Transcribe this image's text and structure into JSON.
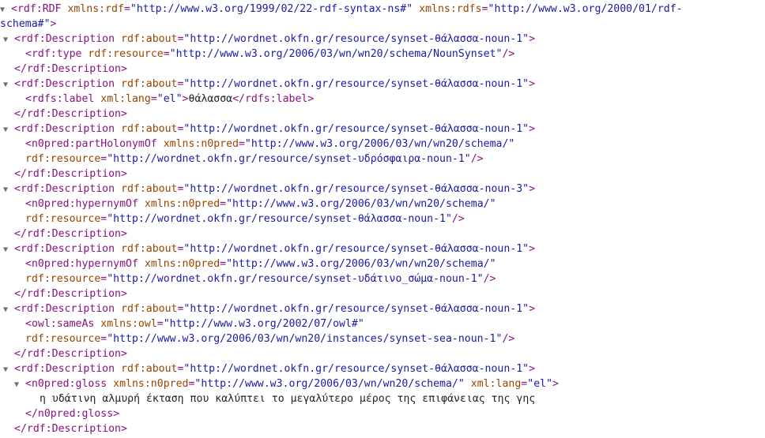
{
  "icons": {
    "toggle": "expanded-triangle-icon",
    "toggle_glyph": "▼"
  },
  "colors": {
    "tag": "#881280",
    "attr_name": "#994500",
    "attr_value": "#1a1aa6",
    "text": "#222222"
  },
  "lines": [
    {
      "indent": 0,
      "toggle": true,
      "interactable": true,
      "name": "rdf-root-open-tag",
      "tokens": [
        {
          "c": "tag",
          "t": "<rdf:RDF"
        },
        {
          "c": "tx",
          "t": " "
        },
        {
          "c": "an",
          "t": "xmlns:rdf"
        },
        {
          "c": "tag",
          "t": "="
        },
        {
          "c": "av",
          "t": "\"http://www.w3.org/1999/02/22-rdf-syntax-ns#\""
        },
        {
          "c": "tx",
          "t": " "
        },
        {
          "c": "an",
          "t": "xmlns:rdfs"
        },
        {
          "c": "tag",
          "t": "="
        },
        {
          "c": "av",
          "t": "\"http://www.w3.org/2000/01/rdf-"
        }
      ]
    },
    {
      "indent": 0,
      "toggle": false,
      "interactable": false,
      "name": "rdf-root-open-tag-cont",
      "tokens": [
        {
          "c": "av",
          "t": "schema#\""
        },
        {
          "c": "tag",
          "t": ">"
        }
      ]
    },
    {
      "indent": 1,
      "toggle": true,
      "interactable": true,
      "name": "description-open-tag",
      "tokens": [
        {
          "c": "tag",
          "t": "<rdf:Description"
        },
        {
          "c": "tx",
          "t": " "
        },
        {
          "c": "an",
          "t": "rdf:about"
        },
        {
          "c": "tag",
          "t": "="
        },
        {
          "c": "av",
          "t": "\"http://wordnet.okfn.gr/resource/synset-θάλασσα-noun-1\""
        },
        {
          "c": "tag",
          "t": ">"
        }
      ]
    },
    {
      "indent": 2,
      "toggle": false,
      "interactable": false,
      "name": "rdf-type-tag",
      "tokens": [
        {
          "c": "tag",
          "t": "<rdf:type"
        },
        {
          "c": "tx",
          "t": " "
        },
        {
          "c": "an",
          "t": "rdf:resource"
        },
        {
          "c": "tag",
          "t": "="
        },
        {
          "c": "av",
          "t": "\"http://www.w3.org/2006/03/wn/wn20/schema/NounSynset\""
        },
        {
          "c": "tag",
          "t": "/>"
        }
      ]
    },
    {
      "indent": 1,
      "toggle": false,
      "interactable": false,
      "name": "description-close-tag",
      "tokens": [
        {
          "c": "tag",
          "t": "</rdf:Description>"
        }
      ]
    },
    {
      "indent": 1,
      "toggle": true,
      "interactable": true,
      "name": "description-open-tag",
      "tokens": [
        {
          "c": "tag",
          "t": "<rdf:Description"
        },
        {
          "c": "tx",
          "t": " "
        },
        {
          "c": "an",
          "t": "rdf:about"
        },
        {
          "c": "tag",
          "t": "="
        },
        {
          "c": "av",
          "t": "\"http://wordnet.okfn.gr/resource/synset-θάλασσα-noun-1\""
        },
        {
          "c": "tag",
          "t": ">"
        }
      ]
    },
    {
      "indent": 2,
      "toggle": false,
      "interactable": false,
      "name": "rdfs-label-element",
      "tokens": [
        {
          "c": "tag",
          "t": "<rdfs:label"
        },
        {
          "c": "tx",
          "t": " "
        },
        {
          "c": "an",
          "t": "xml:lang"
        },
        {
          "c": "tag",
          "t": "="
        },
        {
          "c": "av",
          "t": "\"el\""
        },
        {
          "c": "tag",
          "t": ">"
        },
        {
          "c": "tx",
          "t": "θάλασσα"
        },
        {
          "c": "tag",
          "t": "</rdfs:label>"
        }
      ]
    },
    {
      "indent": 1,
      "toggle": false,
      "interactable": false,
      "name": "description-close-tag",
      "tokens": [
        {
          "c": "tag",
          "t": "</rdf:Description>"
        }
      ]
    },
    {
      "indent": 1,
      "toggle": true,
      "interactable": true,
      "name": "description-open-tag",
      "tokens": [
        {
          "c": "tag",
          "t": "<rdf:Description"
        },
        {
          "c": "tx",
          "t": " "
        },
        {
          "c": "an",
          "t": "rdf:about"
        },
        {
          "c": "tag",
          "t": "="
        },
        {
          "c": "av",
          "t": "\"http://wordnet.okfn.gr/resource/synset-θάλασσα-noun-1\""
        },
        {
          "c": "tag",
          "t": ">"
        }
      ]
    },
    {
      "indent": 2,
      "toggle": false,
      "interactable": false,
      "name": "part-holonym-tag",
      "tokens": [
        {
          "c": "tag",
          "t": "<n0pred:partHolonymOf"
        },
        {
          "c": "tx",
          "t": " "
        },
        {
          "c": "an",
          "t": "xmlns:n0pred"
        },
        {
          "c": "tag",
          "t": "="
        },
        {
          "c": "av",
          "t": "\"http://www.w3.org/2006/03/wn/wn20/schema/\""
        }
      ]
    },
    {
      "indent": 2,
      "toggle": false,
      "interactable": false,
      "name": "part-holonym-tag-cont",
      "tokens": [
        {
          "c": "an",
          "t": "rdf:resource"
        },
        {
          "c": "tag",
          "t": "="
        },
        {
          "c": "av",
          "t": "\"http://wordnet.okfn.gr/resource/synset-υδρόσφαιρα-noun-1\""
        },
        {
          "c": "tag",
          "t": "/>"
        }
      ]
    },
    {
      "indent": 1,
      "toggle": false,
      "interactable": false,
      "name": "description-close-tag",
      "tokens": [
        {
          "c": "tag",
          "t": "</rdf:Description>"
        }
      ]
    },
    {
      "indent": 1,
      "toggle": true,
      "interactable": true,
      "name": "description-open-tag",
      "tokens": [
        {
          "c": "tag",
          "t": "<rdf:Description"
        },
        {
          "c": "tx",
          "t": " "
        },
        {
          "c": "an",
          "t": "rdf:about"
        },
        {
          "c": "tag",
          "t": "="
        },
        {
          "c": "av",
          "t": "\"http://wordnet.okfn.gr/resource/synset-θάλασσα-noun-3\""
        },
        {
          "c": "tag",
          "t": ">"
        }
      ]
    },
    {
      "indent": 2,
      "toggle": false,
      "interactable": false,
      "name": "hypernym-tag",
      "tokens": [
        {
          "c": "tag",
          "t": "<n0pred:hypernymOf"
        },
        {
          "c": "tx",
          "t": " "
        },
        {
          "c": "an",
          "t": "xmlns:n0pred"
        },
        {
          "c": "tag",
          "t": "="
        },
        {
          "c": "av",
          "t": "\"http://www.w3.org/2006/03/wn/wn20/schema/\""
        }
      ]
    },
    {
      "indent": 2,
      "toggle": false,
      "interactable": false,
      "name": "hypernym-tag-cont",
      "tokens": [
        {
          "c": "an",
          "t": "rdf:resource"
        },
        {
          "c": "tag",
          "t": "="
        },
        {
          "c": "av",
          "t": "\"http://wordnet.okfn.gr/resource/synset-θάλασσα-noun-1\""
        },
        {
          "c": "tag",
          "t": "/>"
        }
      ]
    },
    {
      "indent": 1,
      "toggle": false,
      "interactable": false,
      "name": "description-close-tag",
      "tokens": [
        {
          "c": "tag",
          "t": "</rdf:Description>"
        }
      ]
    },
    {
      "indent": 1,
      "toggle": true,
      "interactable": true,
      "name": "description-open-tag",
      "tokens": [
        {
          "c": "tag",
          "t": "<rdf:Description"
        },
        {
          "c": "tx",
          "t": " "
        },
        {
          "c": "an",
          "t": "rdf:about"
        },
        {
          "c": "tag",
          "t": "="
        },
        {
          "c": "av",
          "t": "\"http://wordnet.okfn.gr/resource/synset-θάλασσα-noun-1\""
        },
        {
          "c": "tag",
          "t": ">"
        }
      ]
    },
    {
      "indent": 2,
      "toggle": false,
      "interactable": false,
      "name": "hypernym-tag",
      "tokens": [
        {
          "c": "tag",
          "t": "<n0pred:hypernymOf"
        },
        {
          "c": "tx",
          "t": " "
        },
        {
          "c": "an",
          "t": "xmlns:n0pred"
        },
        {
          "c": "tag",
          "t": "="
        },
        {
          "c": "av",
          "t": "\"http://www.w3.org/2006/03/wn/wn20/schema/\""
        }
      ]
    },
    {
      "indent": 2,
      "toggle": false,
      "interactable": false,
      "name": "hypernym-tag-cont",
      "tokens": [
        {
          "c": "an",
          "t": "rdf:resource"
        },
        {
          "c": "tag",
          "t": "="
        },
        {
          "c": "av",
          "t": "\"http://wordnet.okfn.gr/resource/synset-υδάτινο_σώμα-noun-1\""
        },
        {
          "c": "tag",
          "t": "/>"
        }
      ]
    },
    {
      "indent": 1,
      "toggle": false,
      "interactable": false,
      "name": "description-close-tag",
      "tokens": [
        {
          "c": "tag",
          "t": "</rdf:Description>"
        }
      ]
    },
    {
      "indent": 1,
      "toggle": true,
      "interactable": true,
      "name": "description-open-tag",
      "tokens": [
        {
          "c": "tag",
          "t": "<rdf:Description"
        },
        {
          "c": "tx",
          "t": " "
        },
        {
          "c": "an",
          "t": "rdf:about"
        },
        {
          "c": "tag",
          "t": "="
        },
        {
          "c": "av",
          "t": "\"http://wordnet.okfn.gr/resource/synset-θάλασσα-noun-1\""
        },
        {
          "c": "tag",
          "t": ">"
        }
      ]
    },
    {
      "indent": 2,
      "toggle": false,
      "interactable": false,
      "name": "owl-sameas-tag",
      "tokens": [
        {
          "c": "tag",
          "t": "<owl:sameAs"
        },
        {
          "c": "tx",
          "t": " "
        },
        {
          "c": "an",
          "t": "xmlns:owl"
        },
        {
          "c": "tag",
          "t": "="
        },
        {
          "c": "av",
          "t": "\"http://www.w3.org/2002/07/owl#\""
        }
      ]
    },
    {
      "indent": 2,
      "toggle": false,
      "interactable": false,
      "name": "owl-sameas-tag-cont",
      "tokens": [
        {
          "c": "an",
          "t": "rdf:resource"
        },
        {
          "c": "tag",
          "t": "="
        },
        {
          "c": "av",
          "t": "\"http://www.w3.org/2006/03/wn/wn20/instances/synset-sea-noun-1\""
        },
        {
          "c": "tag",
          "t": "/>"
        }
      ]
    },
    {
      "indent": 1,
      "toggle": false,
      "interactable": false,
      "name": "description-close-tag",
      "tokens": [
        {
          "c": "tag",
          "t": "</rdf:Description>"
        }
      ]
    },
    {
      "indent": 1,
      "toggle": true,
      "interactable": true,
      "name": "description-open-tag",
      "tokens": [
        {
          "c": "tag",
          "t": "<rdf:Description"
        },
        {
          "c": "tx",
          "t": " "
        },
        {
          "c": "an",
          "t": "rdf:about"
        },
        {
          "c": "tag",
          "t": "="
        },
        {
          "c": "av",
          "t": "\"http://wordnet.okfn.gr/resource/synset-θάλασσα-noun-1\""
        },
        {
          "c": "tag",
          "t": ">"
        }
      ]
    },
    {
      "indent": 2,
      "toggle": true,
      "interactable": true,
      "name": "gloss-open-tag",
      "tokens": [
        {
          "c": "tag",
          "t": "<n0pred:gloss"
        },
        {
          "c": "tx",
          "t": " "
        },
        {
          "c": "an",
          "t": "xmlns:n0pred"
        },
        {
          "c": "tag",
          "t": "="
        },
        {
          "c": "av",
          "t": "\"http://www.w3.org/2006/03/wn/wn20/schema/\""
        },
        {
          "c": "tx",
          "t": " "
        },
        {
          "c": "an",
          "t": "xml:lang"
        },
        {
          "c": "tag",
          "t": "="
        },
        {
          "c": "av",
          "t": "\"el\""
        },
        {
          "c": "tag",
          "t": ">"
        }
      ]
    },
    {
      "indent": 3,
      "toggle": false,
      "interactable": false,
      "name": "gloss-text",
      "tokens": [
        {
          "c": "tx",
          "t": "η υδάτινη αλμυρή έκταση που καλύπτει το μεγαλύτερο μέρος της επιφάνειας της γης"
        }
      ]
    },
    {
      "indent": 2,
      "toggle": false,
      "interactable": false,
      "name": "gloss-close-tag",
      "tokens": [
        {
          "c": "tag",
          "t": "</n0pred:gloss>"
        }
      ]
    },
    {
      "indent": 1,
      "toggle": false,
      "interactable": false,
      "name": "description-close-tag",
      "tokens": [
        {
          "c": "tag",
          "t": "</rdf:Description>"
        }
      ]
    }
  ]
}
